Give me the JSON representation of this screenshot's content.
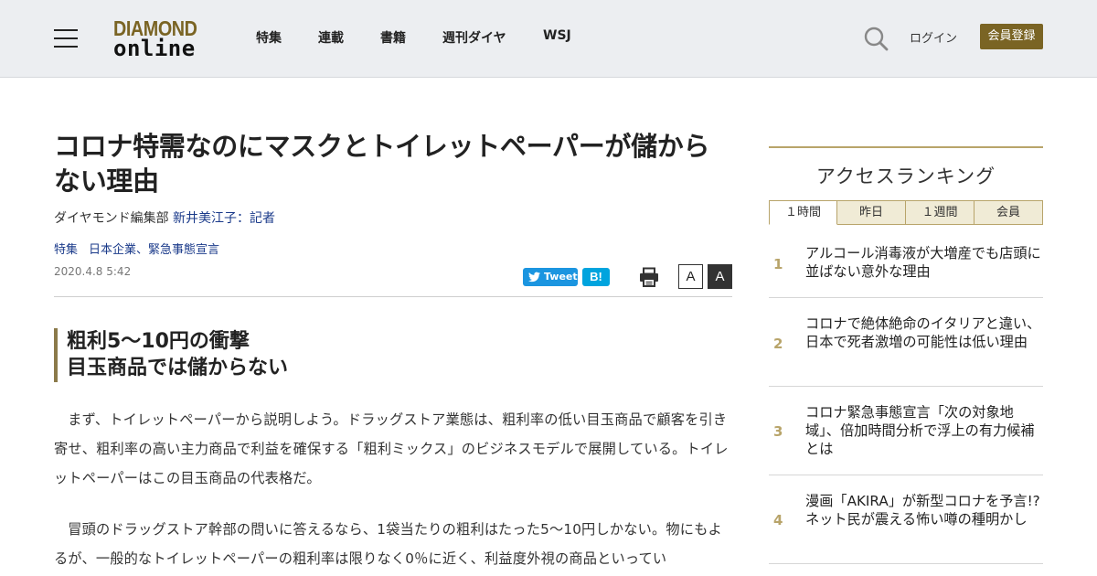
{
  "header": {
    "logo_top": "DIAMOND",
    "logo_bottom": "online",
    "nav": [
      {
        "label": "特集"
      },
      {
        "label": "連載"
      },
      {
        "label": "書籍"
      },
      {
        "label": "週刊ダイヤ"
      },
      {
        "label": "WSJ"
      }
    ],
    "login": "ログイン",
    "register": "会員登録"
  },
  "article": {
    "title": "コロナ特需なのにマスクとトイレットペーパーが儲からない理由",
    "byline_prefix": "ダイヤモンド編集部 ",
    "author": "新井美江子：記者",
    "tags": [
      "特集",
      "日本企業、緊急事態宣言"
    ],
    "date": "2020.4.8 5:42",
    "tweet_label": "Tweet",
    "hatena_label": "B!",
    "font_small_label": "A",
    "font_large_label": "A",
    "subhead_line1": "粗利5～10円の衝撃",
    "subhead_line2": "目玉商品では儲からない",
    "paragraph1": "まず、トイレットペーパーから説明しよう。ドラッグストア業態は、粗利率の低い目玉商品で顧客を引き寄せ、粗利率の高い主力商品で利益を確保する「粗利ミックス」のビジネスモデルで展開している。トイレットペーパーはこの目玉商品の代表格だ。",
    "paragraph2": "冒頭のドラッグストア幹部の問いに答えるなら、1袋当たりの粗利はたった5～10円しかない。物にもよるが、一般的なトイレットペーパーの粗利率は限りなく0％に近く、利益度外視の商品といってい"
  },
  "sidebar": {
    "title": "アクセスランキング",
    "tabs": [
      {
        "label": "１時間",
        "active": true
      },
      {
        "label": "昨日",
        "active": false
      },
      {
        "label": "１週間",
        "active": false
      },
      {
        "label": "会員",
        "active": false
      }
    ],
    "rankings": [
      {
        "rank": "1",
        "title": "アルコール消毒液が大増産でも店頭に並ばない意外な理由"
      },
      {
        "rank": "2",
        "title": "コロナで絶体絶命のイタリアと違い、日本で死者激増の可能性は低い理由"
      },
      {
        "rank": "3",
        "title": "コロナ緊急事態宣言「次の対象地域」、倍加時間分析で浮上の有力候補とは"
      },
      {
        "rank": "4",
        "title": "漫画「AKIRA」が新型コロナを予言!?ネット民が震える怖い噂の種明かし"
      }
    ]
  },
  "colors": {
    "brand_gold": "#7a6424",
    "accent_gold": "#b8a46a",
    "link_blue": "#1a3a8a",
    "tweet_blue": "#1b95e0",
    "hatena_blue": "#00a4de"
  },
  "icons": [
    "hamburger-menu-icon",
    "search-icon",
    "twitter-bird-icon",
    "printer-icon"
  ]
}
